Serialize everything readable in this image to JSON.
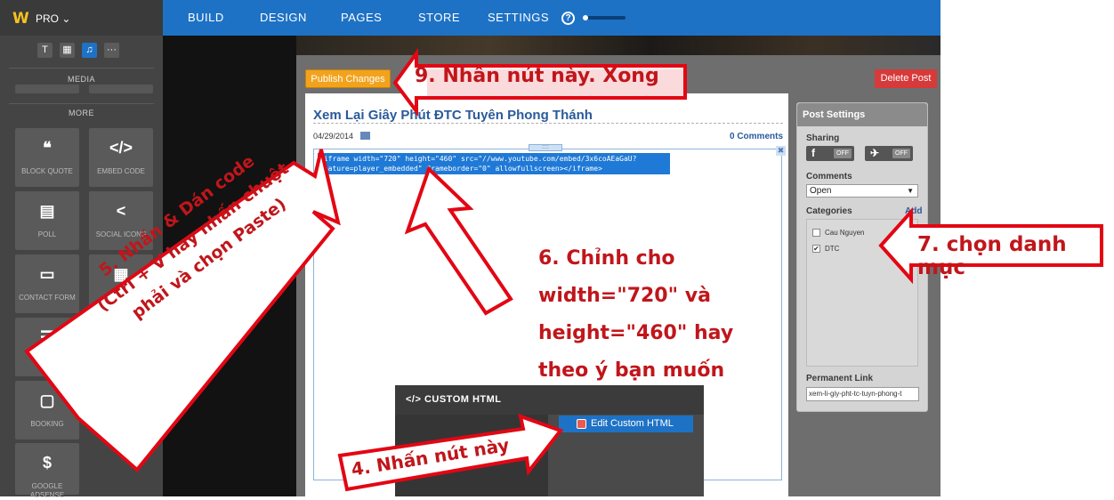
{
  "topbar": {
    "logo": "W",
    "pro": "PRO ⌄",
    "nav": [
      {
        "label": "BUILD"
      },
      {
        "label": "DESIGN"
      },
      {
        "label": "PAGES"
      },
      {
        "label": "STORE"
      },
      {
        "label": "SETTINGS"
      }
    ],
    "help": "?"
  },
  "sidebar": {
    "tools": [
      "T",
      "▦",
      "♫",
      "···"
    ],
    "media_label": "MEDIA",
    "more_label": "MORE",
    "tiles": [
      {
        "icon": "❝",
        "label": "BLOCK QUOTE"
      },
      {
        "icon": "</>",
        "label": "EMBED CODE"
      },
      {
        "icon": "▤",
        "label": "POLL"
      },
      {
        "icon": "<",
        "label": "SOCIAL ICONS"
      },
      {
        "icon": "▭",
        "label": "CONTACT FORM"
      },
      {
        "icon": "▦",
        "label": ""
      },
      {
        "icon": "☰",
        "label": ""
      },
      {
        "icon": "▢",
        "label": "BOOKING"
      },
      {
        "icon": "$",
        "label": "GOOGLE ADSENSE"
      }
    ]
  },
  "editor": {
    "publish_label": "Publish Changes",
    "delete_label": "Delete Post",
    "post_title": "Xem Lại Giây Phút ĐTC Tuyên Phong Thánh",
    "date": "04/29/2014",
    "comments_count": "0 Comments",
    "code": "<iframe width=\"720\" height=\"460\" src=\"//www.youtube.com/embed/3x6coAEaGaU?\nfeature=player_embedded\" frameborder=\"0\" allowfullscreen></iframe>"
  },
  "post_settings": {
    "title": "Post Settings",
    "sharing_label": "Sharing",
    "facebook_off": "OFF",
    "twitter_off": "OFF",
    "comments_label": "Comments",
    "comments_value": "Open",
    "categories_label": "Categories",
    "add_label": "Add",
    "categories": [
      {
        "name": "Cau Nguyen",
        "checked": false
      },
      {
        "name": "DTC",
        "checked": true
      }
    ],
    "permalink_label": "Permanent Link",
    "permalink_value": "xem-li-giy-pht-tc-tuyn-phong-t"
  },
  "custom_html": {
    "header": "</> CUSTOM HTML",
    "edit_button": "Edit Custom HTML"
  },
  "annotations": {
    "a9": "9. Nhấn nút này. Xong",
    "a6_line1": "6. Chỉnh cho",
    "a6_line2": "width=\"720\" và",
    "a6_line3": "height=\"460\" hay",
    "a6_line4": "theo ý bạn muốn",
    "a7": "7. chọn danh mục",
    "a5_line1": "5. Nhấn & Dán code",
    "a5_line2": "(Ctrl + V hay nhấn chuột",
    "a5_line3": "phải và chọn Paste)",
    "a4": "4. Nhấn nút này"
  },
  "colors": {
    "topbar": "#1e72c5",
    "annotation_red": "#e30613",
    "annotation_text": "#c0161b"
  }
}
